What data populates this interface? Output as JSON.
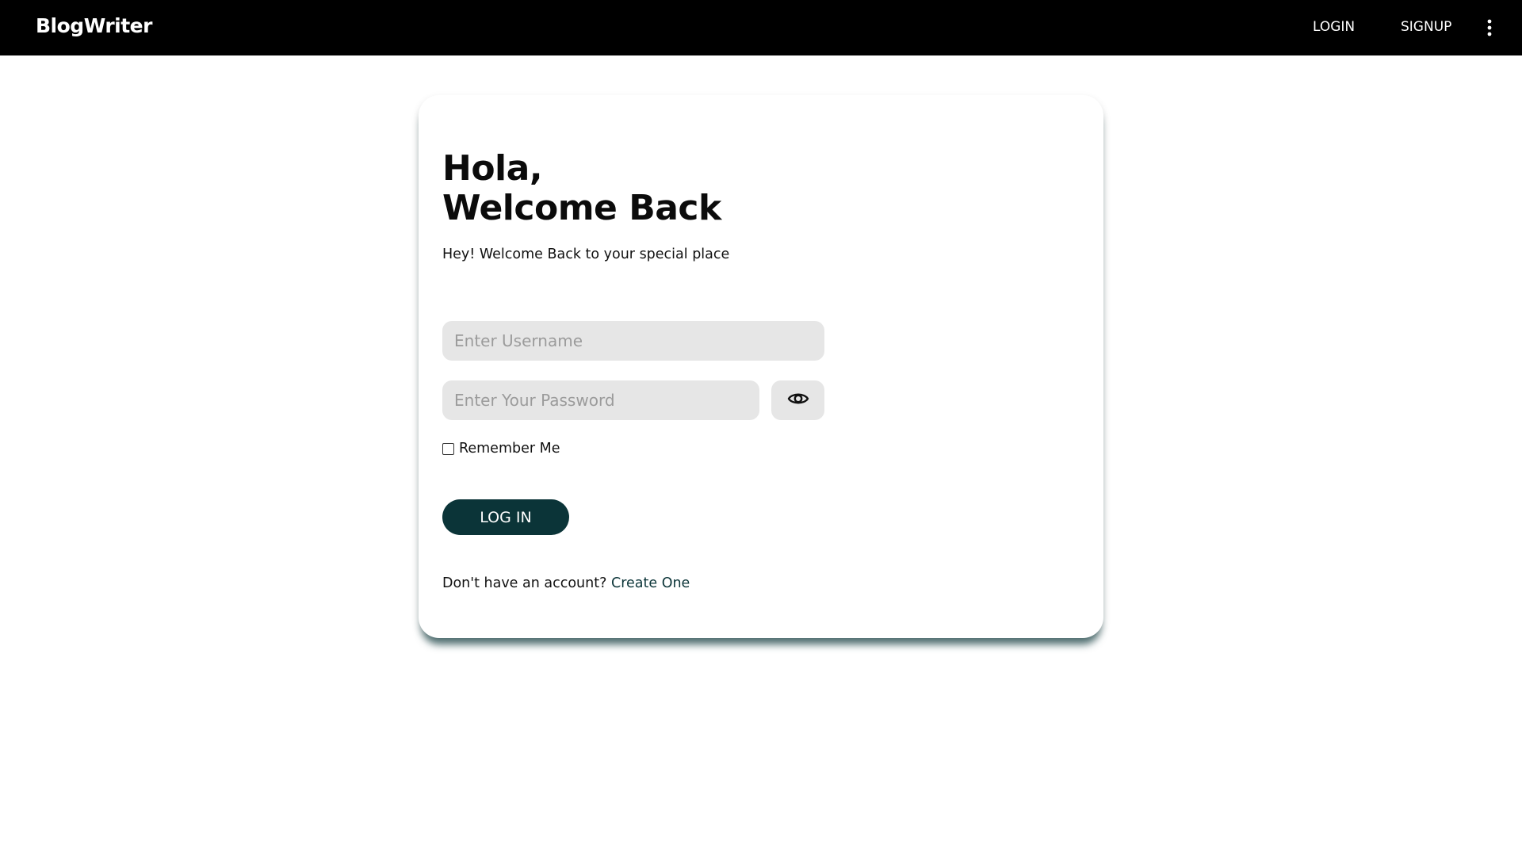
{
  "navbar": {
    "brand": "BlogWriter",
    "login_label": "LOGIN",
    "signup_label": "SIGNUP",
    "more_icon": "more-vertical-icon"
  },
  "card": {
    "heading_line1": "Hola,",
    "heading_line2": "Welcome Back",
    "subtitle": "Hey! Welcome Back to your special place",
    "username": {
      "placeholder": "Enter Username",
      "value": ""
    },
    "password": {
      "placeholder": "Enter Your Password",
      "value": ""
    },
    "toggle_icon": "eye-icon",
    "remember_label": "Remember Me",
    "remember_checked": false,
    "login_button_label": "LOG IN",
    "signup_prompt": "Don't have an account?",
    "signup_link": "Create One"
  },
  "colors": {
    "navbar_bg": "#000000",
    "accent": "#0b3438",
    "input_bg": "#e6e6e6"
  }
}
